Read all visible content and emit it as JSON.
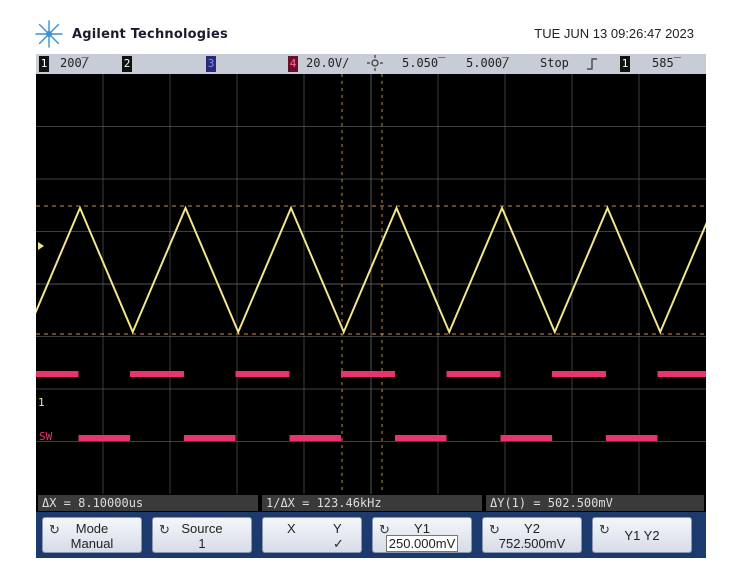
{
  "header": {
    "brand": "Agilent Technologies",
    "datetime": "TUE JUN 13 09:26:47 2023"
  },
  "status": {
    "ch1_num": "1",
    "ch1_scale": "200̅/",
    "ch2_num": "2",
    "ch3_num": "3",
    "ch4_num": "4",
    "ch4_scale": "20.0V/",
    "time_pos": "5.050̅",
    "time_scale": "5.000̅/",
    "run_state": "Stop",
    "trig_num": "1",
    "trig_level": "585̅"
  },
  "screen": {
    "ch1_label": "1",
    "sw_label": "SW",
    "ch1_marker": "1",
    "colors": {
      "triangle": "#f2e68c",
      "pulse": "#e8336f",
      "grid": "#6a6a6a",
      "cursor_h": "#d4884a",
      "cursor_v": "#b8913f"
    }
  },
  "measurements": {
    "dx": "ΔX = 8.10000us",
    "inv_dx": "1/ΔX = 123.46kHz",
    "dy": "ΔY(1) = 502.500mV"
  },
  "softkeys": {
    "mode_label": "Mode",
    "mode_value": "Manual",
    "source_label": "Source",
    "source_value": "1",
    "x_label": "X",
    "y_label": "Y",
    "y_check": "✓",
    "y1_label": "Y1",
    "y1_value": "250.000mV",
    "y2_label": "Y2",
    "y2_value": "752.500mV",
    "y1y2_label": "Y1 Y2"
  }
}
